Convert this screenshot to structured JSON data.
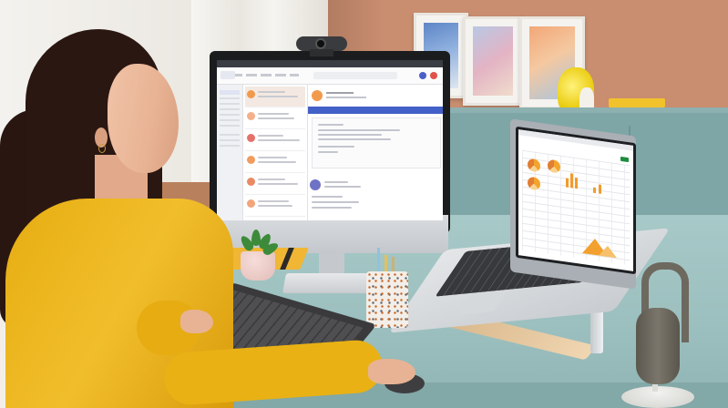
{
  "scene": {
    "description_free": true,
    "colors": {
      "wall": "#c98d6f",
      "sideboard": "#7fa6a7",
      "desk": "#a7c9c8",
      "sweater": "#f1be2b",
      "hair": "#2b1712"
    }
  },
  "monitor_ui": {
    "titlebar_text": "",
    "search_placeholder": "",
    "banner_text": "",
    "icons": [
      "search-icon",
      "avatar-icon"
    ],
    "accent_color": "#4260c8"
  },
  "laptop_ui": {
    "accent_color": "#1e8e3e",
    "chart_accent": "#f29b2c"
  }
}
